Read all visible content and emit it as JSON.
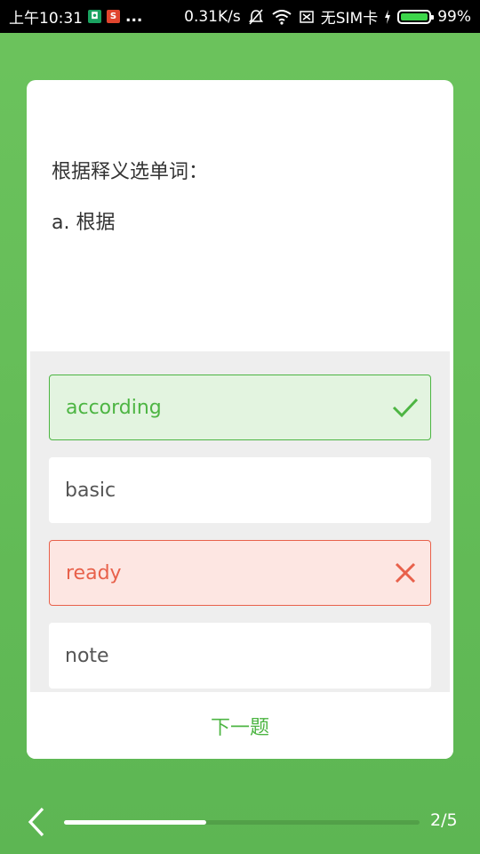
{
  "status_bar": {
    "time": "上午10:31",
    "dots": "...",
    "speed": "0.31K/s",
    "sim": "无SIM卡",
    "battery": "99%"
  },
  "question": {
    "prompt": "根据释义选单词：",
    "meaning": "a. 根据"
  },
  "options": [
    {
      "label": "according",
      "state": "correct"
    },
    {
      "label": "basic",
      "state": "neutral"
    },
    {
      "label": "ready",
      "state": "wrong"
    },
    {
      "label": "note",
      "state": "neutral"
    }
  ],
  "next_button": "下一题",
  "progress": {
    "current": 2,
    "total": 5,
    "text": "2/5",
    "fraction": 0.4
  },
  "colors": {
    "accent": "#4db543",
    "error": "#e8614b",
    "background": "#6cc35d"
  }
}
